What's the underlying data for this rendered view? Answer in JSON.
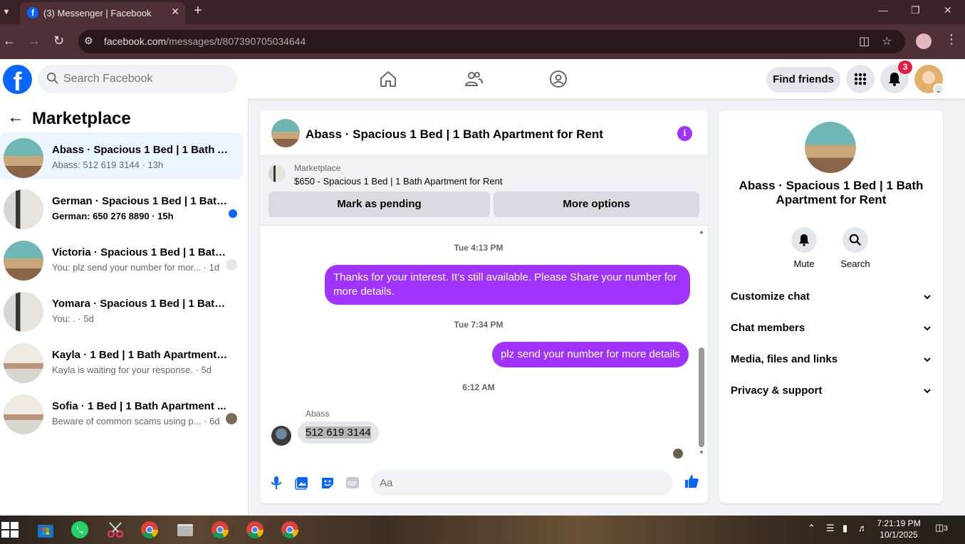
{
  "browser": {
    "tab_title": "(3) Messenger | Facebook",
    "url_host": "facebook.com",
    "url_path": "/messages/t/807390705034644"
  },
  "header": {
    "search_placeholder": "Search Facebook",
    "find_friends_label": "Find friends",
    "notification_count": "3"
  },
  "sidebar": {
    "title": "Marketplace",
    "conversations": [
      {
        "name": "Abass · Spacious 1 Bed | 1 Bath Ap...",
        "snippet": "Abass: 512 619 3144 · 13h",
        "active": true,
        "unread": false
      },
      {
        "name": "German · Spacious 1 Bed | 1 Bath...",
        "snippet": "German: 650 276 8890 · 15h",
        "active": false,
        "unread": true
      },
      {
        "name": "Victoria · Spacious 1 Bed | 1 Bath...",
        "snippet": "You: plz send your number for mor... · 1d",
        "active": false,
        "unread": false
      },
      {
        "name": "Yomara · Spacious 1 Bed | 1 Bath A...",
        "snippet": "You: . · 5d",
        "active": false,
        "unread": false
      },
      {
        "name": "Kayla · 1 Bed | 1 Bath Apartment fo...",
        "snippet": "Kayla is waiting for your response. · 5d",
        "active": false,
        "unread": false
      },
      {
        "name": "Sofia · 1 Bed | 1 Bath Apartment ...",
        "snippet": "Beware of common scams using p... · 6d",
        "active": false,
        "unread": false
      }
    ]
  },
  "chat": {
    "title": "Abass · Spacious 1 Bed | 1 Bath Apartment for Rent",
    "marketplace_label": "Marketplace",
    "item": "$650 - Spacious 1 Bed | 1 Bath Apartment for Rent",
    "mark_pending_label": "Mark as pending",
    "more_options_label": "More options",
    "messages": [
      {
        "timestamp": "Tue 4:13 PM",
        "text": "Thanks for your interest.  It's still available. Please Share your number for more details."
      },
      {
        "timestamp": "Tue 7:34 PM",
        "text": "plz send your number for more details"
      },
      {
        "timestamp": "6:12 AM",
        "sender": "Abass",
        "text": "512 619 3144"
      }
    ],
    "composer_placeholder": "Aa"
  },
  "details": {
    "title": "Abass · Spacious 1 Bed | 1 Bath Apartment for Rent",
    "mute_label": "Mute",
    "search_label": "Search",
    "sections": [
      "Customize chat",
      "Chat members",
      "Media, files and links",
      "Privacy & support"
    ]
  },
  "taskbar": {
    "time": "7:21:19 PM",
    "date": "10/1/2025",
    "notification_count": "3"
  },
  "colors": {
    "fb_blue": "#0866ff",
    "messenger_purple": "#a033ff",
    "notification_red": "#e41e3f"
  }
}
